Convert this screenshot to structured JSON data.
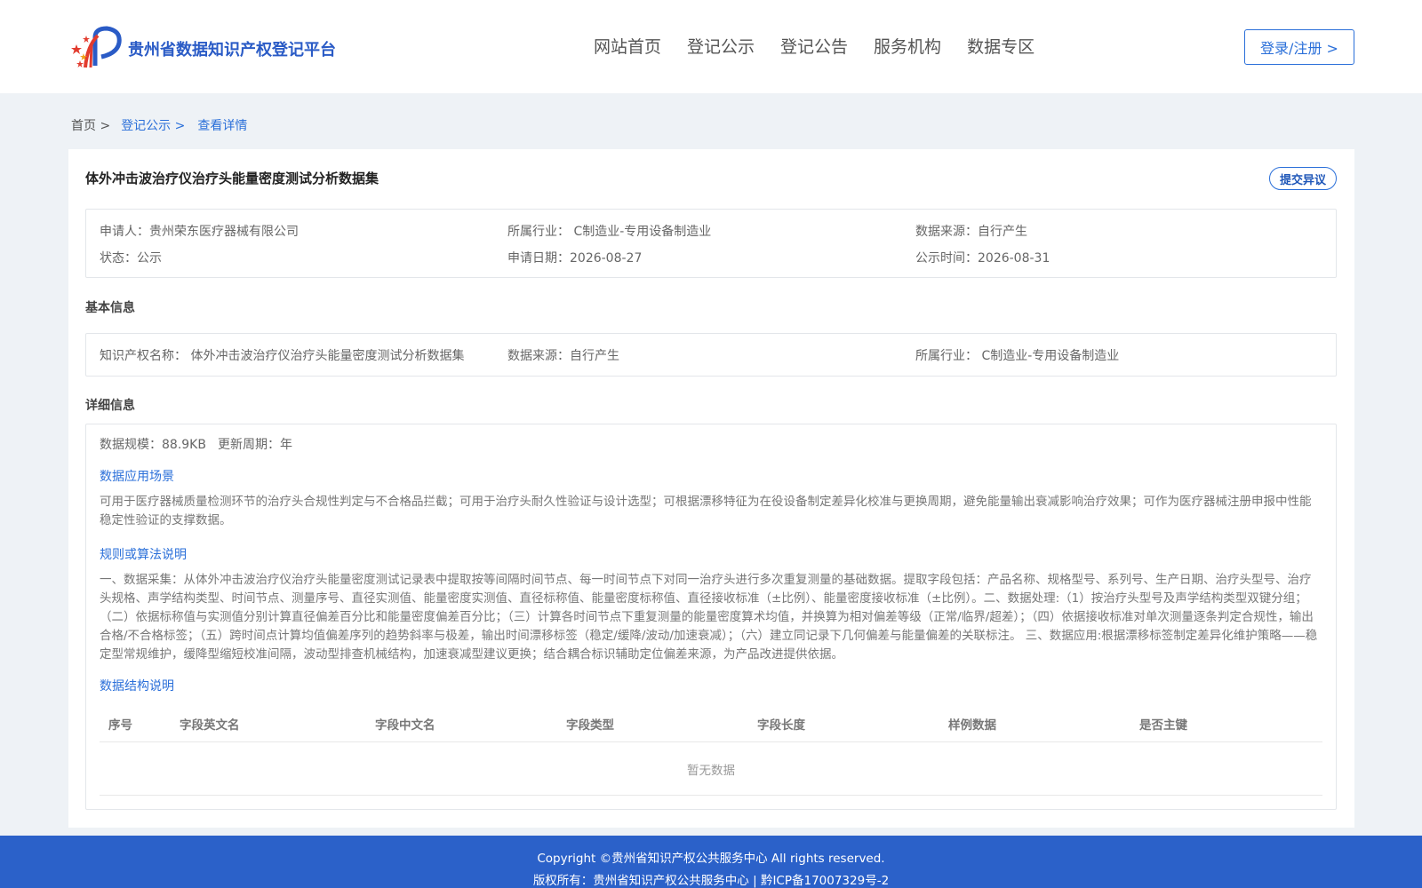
{
  "header": {
    "site_title": "贵州省数据知识产权登记平台",
    "nav": [
      "网站首页",
      "登记公示",
      "登记公告",
      "服务机构",
      "数据专区"
    ],
    "login_label": "登录/注册 >"
  },
  "breadcrumb": {
    "home": "首页 >",
    "section": "登记公示 >",
    "current": "查看详情"
  },
  "record": {
    "title": "体外冲击波治疗仪治疗头能量密度测试分析数据集",
    "objection_label": "提交异议",
    "summary": {
      "applicant_label": "申请人：",
      "applicant": "贵州荣东医疗器械有限公司",
      "industry_label": "所属行业：",
      "industry": "C制造业-专用设备制造业",
      "source_label": "数据来源：",
      "source": "自行产生",
      "status_label": "状态：",
      "status": "公示",
      "apply_date_label": "申请日期：",
      "apply_date": "2026-08-27",
      "publish_date_label": "公示时间：",
      "publish_date": "2026-08-31"
    },
    "basic": {
      "section_title": "基本信息",
      "ip_name_label": "知识产权名称：",
      "ip_name": "体外冲击波治疗仪治疗头能量密度测试分析数据集",
      "source_label": "数据来源：",
      "source": "自行产生",
      "industry_label": "所属行业：",
      "industry": "C制造业-专用设备制造业"
    },
    "detail": {
      "section_title": "详细信息",
      "scale_label": "数据规模：",
      "scale": "88.9KB",
      "cycle_label": "更新周期：",
      "cycle": "年",
      "scene_title": "数据应用场景",
      "scene_text": "可用于医疗器械质量检测环节的治疗头合规性判定与不合格品拦截；可用于治疗头耐久性验证与设计选型；可根据漂移特征为在役设备制定差异化校准与更换周期，避免能量输出衰减影响治疗效果；可作为医疗器械注册申报中性能稳定性验证的支撑数据。",
      "rule_title": "规则或算法说明",
      "rule_text": "一、数据采集：从体外冲击波治疗仪治疗头能量密度测试记录表中提取按等间隔时间节点、每一时间节点下对同一治疗头进行多次重复测量的基础数据。提取字段包括：产品名称、规格型号、系列号、生产日期、治疗头型号、治疗头规格、声学结构类型、时间节点、测量序号、直径实测值、能量密度实测值、直径标称值、能量密度标称值、直径接收标准（±比例）、能量密度接收标准（±比例）。二、数据处理:（1）按治疗头型号及声学结构类型双键分组；（二）依据标称值与实测值分别计算直径偏差百分比和能量密度偏差百分比；（三）计算各时间节点下重复测量的能量密度算术均值，并换算为相对偏差等级（正常/临界/超差）；（四）依据接收标准对单次测量逐条判定合规性，输出合格/不合格标签；（五）跨时间点计算均值偏差序列的趋势斜率与极差，输出时间漂移标签（稳定/缓降/波动/加速衰减）；（六）建立同记录下几何偏差与能量偏差的关联标注。 三、数据应用:根据漂移标签制定差异化维护策略——稳定型常规维护，缓降型缩短校准间隔，波动型排查机械结构，加速衰减型建议更换；结合耦合标识辅助定位偏差来源，为产品改进提供依据。",
      "struct_title": "数据结构说明",
      "table_headers": [
        "序号",
        "字段英文名",
        "字段中文名",
        "字段类型",
        "字段长度",
        "样例数据",
        "是否主键"
      ],
      "table_empty": "暂无数据"
    }
  },
  "footer": {
    "copyright": "Copyright ©贵州省知识产权公共服务中心 All rights reserved.",
    "owner": "版权所有：贵州省知识产权公共服务中心 | 黔ICP备17007329号-2"
  },
  "colors": {
    "brand_blue": "#2a5bc6",
    "link_blue": "#2a6fd9",
    "footer_blue": "#2b61c9",
    "logo_red": "#e23b2e",
    "logo_orange": "#f0a21b"
  }
}
